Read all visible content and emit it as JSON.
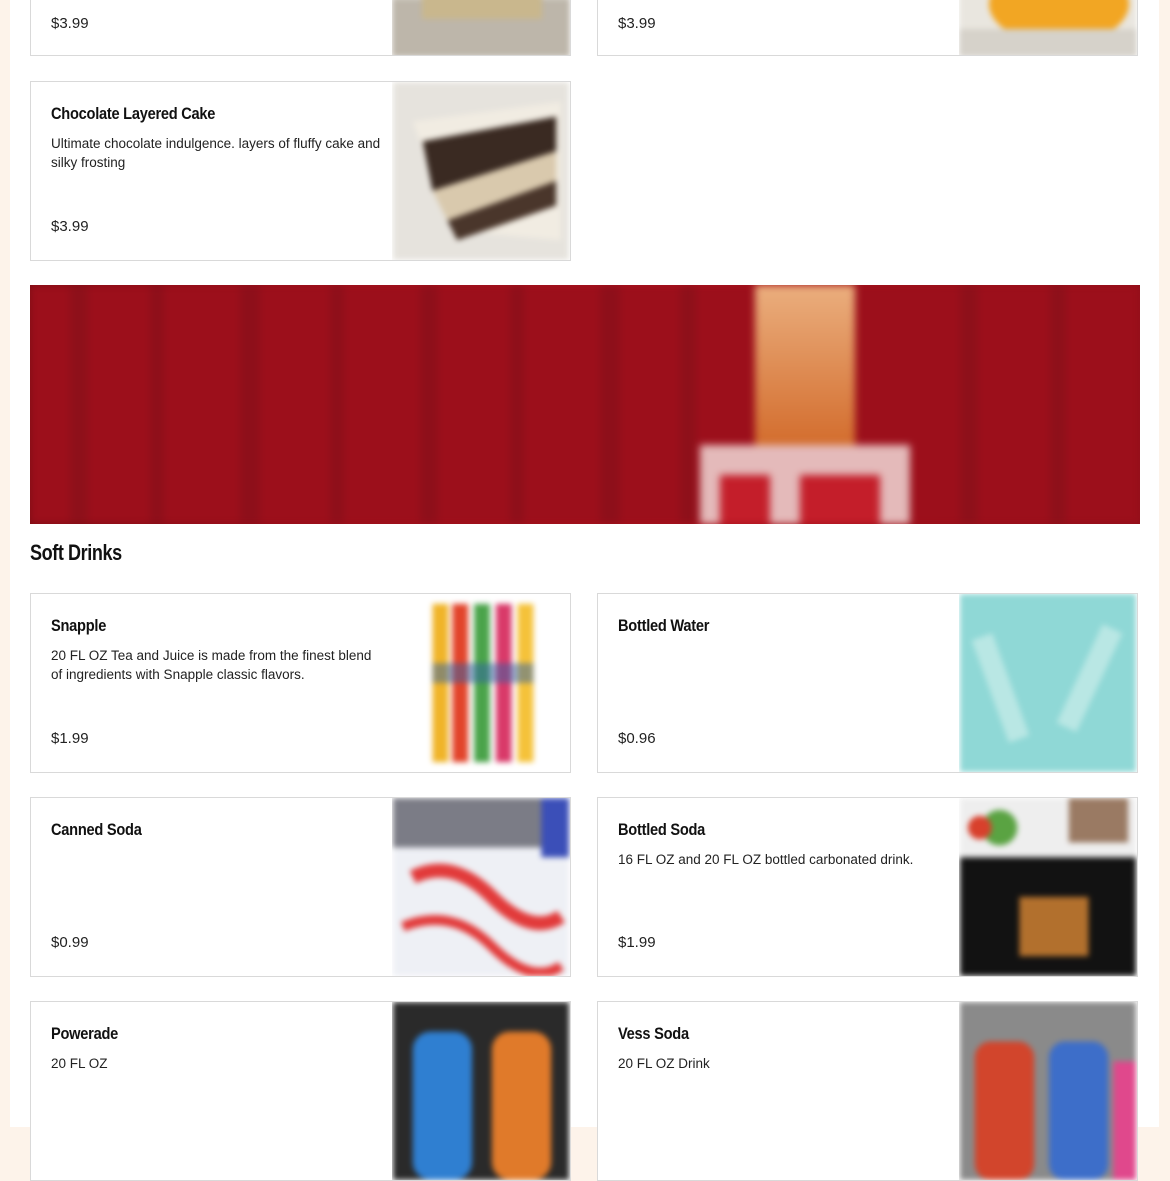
{
  "top_cards": [
    {
      "price": "$3.99"
    },
    {
      "price": "$3.99"
    }
  ],
  "desserts": [
    {
      "title": "Chocolate Layered Cake",
      "desc": "Ultimate chocolate indulgence. layers of fluffy cake and silky frosting",
      "price": "$3.99"
    }
  ],
  "soft_drinks": {
    "heading": "Soft Drinks",
    "items": [
      {
        "title": "Snapple",
        "desc": "20 FL OZ Tea and Juice is made from the finest blend of ingredients with Snapple classic flavors.",
        "price": "$1.99"
      },
      {
        "title": "Bottled Water",
        "desc": "",
        "price": "$0.96"
      },
      {
        "title": "Canned Soda",
        "desc": "",
        "price": "$0.99"
      },
      {
        "title": "Bottled Soda",
        "desc": "16 FL OZ and 20 FL OZ bottled carbonated drink.",
        "price": "$1.99"
      },
      {
        "title": "Powerade",
        "desc": "20 FL OZ",
        "price": ""
      },
      {
        "title": "Vess Soda",
        "desc": "20 FL OZ Drink",
        "price": ""
      }
    ]
  },
  "colors": {
    "page_bg": "#fdf3ea",
    "banner_red": "#a8111d",
    "border": "#d9d9d9"
  }
}
